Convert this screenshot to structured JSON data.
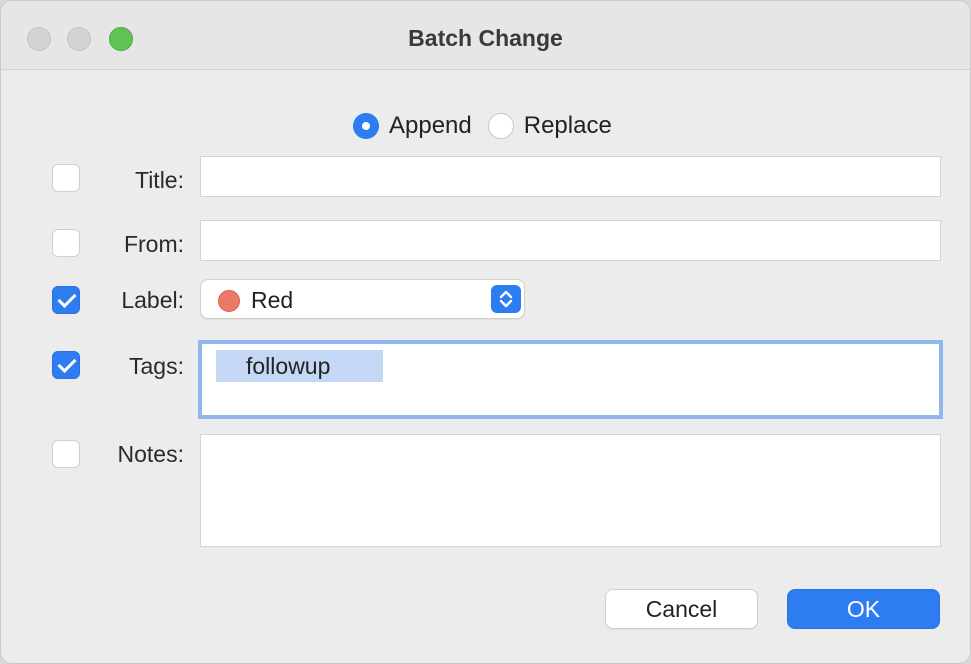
{
  "window": {
    "title": "Batch Change"
  },
  "mode": {
    "options": [
      {
        "label": "Append",
        "selected": true
      },
      {
        "label": "Replace",
        "selected": false
      }
    ]
  },
  "fields": {
    "title": {
      "label": "Title:",
      "checked": false,
      "value": ""
    },
    "from": {
      "label": "From:",
      "checked": false,
      "value": ""
    },
    "label": {
      "label": "Label:",
      "checked": true,
      "value": "Red",
      "color": "#ec7866"
    },
    "tags": {
      "label": "Tags:",
      "checked": true,
      "tokens": [
        "followup"
      ]
    },
    "notes": {
      "label": "Notes:",
      "checked": false,
      "value": ""
    }
  },
  "buttons": {
    "cancel": "Cancel",
    "ok": "OK"
  },
  "colors": {
    "accent": "#2d7cf2",
    "tag_chip": "#c4d8f6",
    "focus_ring": "#8fb6ef"
  }
}
